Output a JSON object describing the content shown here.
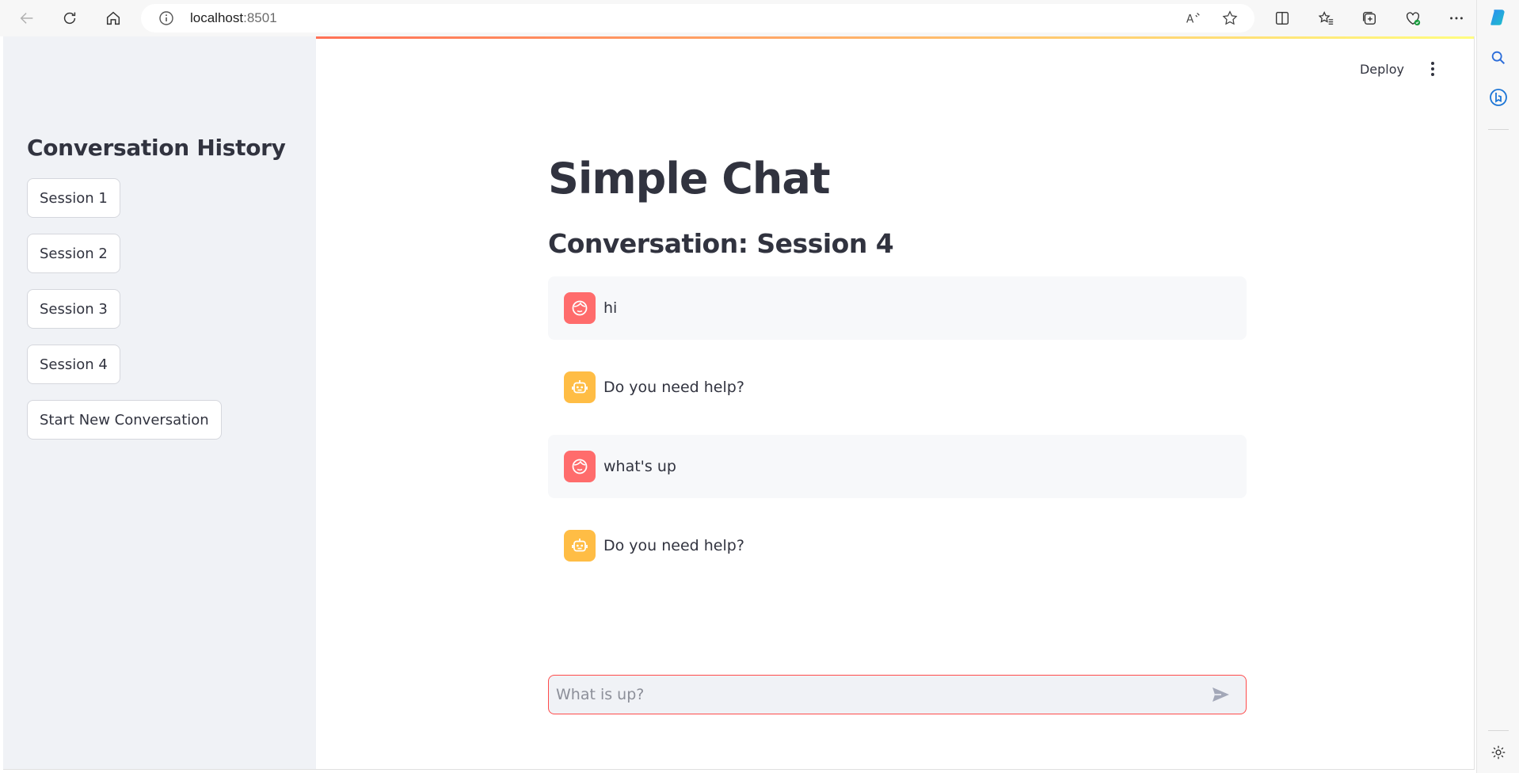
{
  "browser": {
    "url_host": "localhost",
    "url_port": ":8501"
  },
  "app": {
    "accent_color": "#ff4b4b",
    "header": {
      "deploy_label": "Deploy"
    },
    "sidebar": {
      "title": "Conversation History",
      "sessions": [
        {
          "label": "Session 1"
        },
        {
          "label": "Session 2"
        },
        {
          "label": "Session 3"
        },
        {
          "label": "Session 4"
        }
      ],
      "new_conversation_label": "Start New Conversation"
    },
    "main": {
      "title": "Simple Chat",
      "subtitle": "Conversation: Session 4",
      "messages": [
        {
          "role": "user",
          "avatar_icon": "user-face-icon",
          "text": "hi"
        },
        {
          "role": "assistant",
          "avatar_icon": "robot-icon",
          "text": "Do you need help?"
        },
        {
          "role": "user",
          "avatar_icon": "user-face-icon",
          "text": "what's up"
        },
        {
          "role": "assistant",
          "avatar_icon": "robot-icon",
          "text": "Do you need help?"
        }
      ],
      "chat_input": {
        "placeholder": "What is up?",
        "value": ""
      }
    }
  }
}
